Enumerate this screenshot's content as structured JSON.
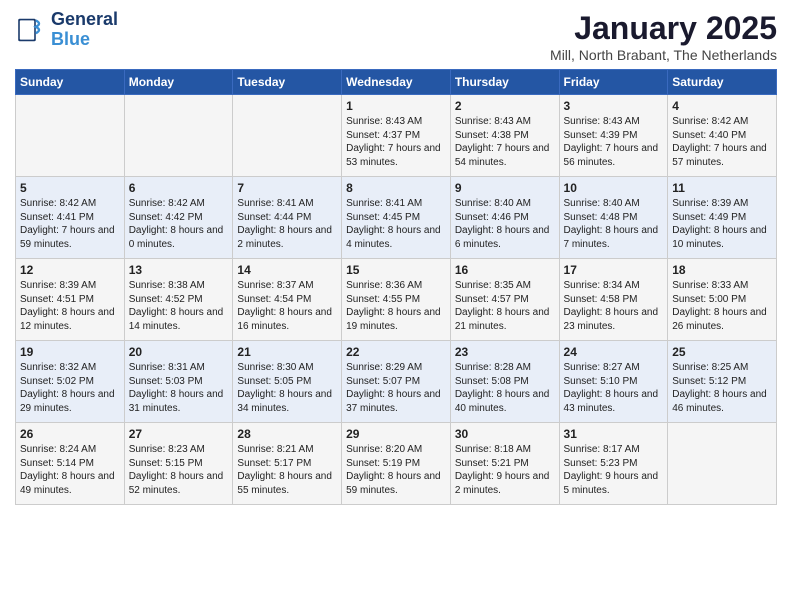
{
  "header": {
    "logo_line1": "General",
    "logo_line2": "Blue",
    "title": "January 2025",
    "subtitle": "Mill, North Brabant, The Netherlands"
  },
  "days_of_week": [
    "Sunday",
    "Monday",
    "Tuesday",
    "Wednesday",
    "Thursday",
    "Friday",
    "Saturday"
  ],
  "weeks": [
    [
      {
        "day": "",
        "info": ""
      },
      {
        "day": "",
        "info": ""
      },
      {
        "day": "",
        "info": ""
      },
      {
        "day": "1",
        "info": "Sunrise: 8:43 AM\nSunset: 4:37 PM\nDaylight: 7 hours and 53 minutes."
      },
      {
        "day": "2",
        "info": "Sunrise: 8:43 AM\nSunset: 4:38 PM\nDaylight: 7 hours and 54 minutes."
      },
      {
        "day": "3",
        "info": "Sunrise: 8:43 AM\nSunset: 4:39 PM\nDaylight: 7 hours and 56 minutes."
      },
      {
        "day": "4",
        "info": "Sunrise: 8:42 AM\nSunset: 4:40 PM\nDaylight: 7 hours and 57 minutes."
      }
    ],
    [
      {
        "day": "5",
        "info": "Sunrise: 8:42 AM\nSunset: 4:41 PM\nDaylight: 7 hours and 59 minutes."
      },
      {
        "day": "6",
        "info": "Sunrise: 8:42 AM\nSunset: 4:42 PM\nDaylight: 8 hours and 0 minutes."
      },
      {
        "day": "7",
        "info": "Sunrise: 8:41 AM\nSunset: 4:44 PM\nDaylight: 8 hours and 2 minutes."
      },
      {
        "day": "8",
        "info": "Sunrise: 8:41 AM\nSunset: 4:45 PM\nDaylight: 8 hours and 4 minutes."
      },
      {
        "day": "9",
        "info": "Sunrise: 8:40 AM\nSunset: 4:46 PM\nDaylight: 8 hours and 6 minutes."
      },
      {
        "day": "10",
        "info": "Sunrise: 8:40 AM\nSunset: 4:48 PM\nDaylight: 8 hours and 7 minutes."
      },
      {
        "day": "11",
        "info": "Sunrise: 8:39 AM\nSunset: 4:49 PM\nDaylight: 8 hours and 10 minutes."
      }
    ],
    [
      {
        "day": "12",
        "info": "Sunrise: 8:39 AM\nSunset: 4:51 PM\nDaylight: 8 hours and 12 minutes."
      },
      {
        "day": "13",
        "info": "Sunrise: 8:38 AM\nSunset: 4:52 PM\nDaylight: 8 hours and 14 minutes."
      },
      {
        "day": "14",
        "info": "Sunrise: 8:37 AM\nSunset: 4:54 PM\nDaylight: 8 hours and 16 minutes."
      },
      {
        "day": "15",
        "info": "Sunrise: 8:36 AM\nSunset: 4:55 PM\nDaylight: 8 hours and 19 minutes."
      },
      {
        "day": "16",
        "info": "Sunrise: 8:35 AM\nSunset: 4:57 PM\nDaylight: 8 hours and 21 minutes."
      },
      {
        "day": "17",
        "info": "Sunrise: 8:34 AM\nSunset: 4:58 PM\nDaylight: 8 hours and 23 minutes."
      },
      {
        "day": "18",
        "info": "Sunrise: 8:33 AM\nSunset: 5:00 PM\nDaylight: 8 hours and 26 minutes."
      }
    ],
    [
      {
        "day": "19",
        "info": "Sunrise: 8:32 AM\nSunset: 5:02 PM\nDaylight: 8 hours and 29 minutes."
      },
      {
        "day": "20",
        "info": "Sunrise: 8:31 AM\nSunset: 5:03 PM\nDaylight: 8 hours and 31 minutes."
      },
      {
        "day": "21",
        "info": "Sunrise: 8:30 AM\nSunset: 5:05 PM\nDaylight: 8 hours and 34 minutes."
      },
      {
        "day": "22",
        "info": "Sunrise: 8:29 AM\nSunset: 5:07 PM\nDaylight: 8 hours and 37 minutes."
      },
      {
        "day": "23",
        "info": "Sunrise: 8:28 AM\nSunset: 5:08 PM\nDaylight: 8 hours and 40 minutes."
      },
      {
        "day": "24",
        "info": "Sunrise: 8:27 AM\nSunset: 5:10 PM\nDaylight: 8 hours and 43 minutes."
      },
      {
        "day": "25",
        "info": "Sunrise: 8:25 AM\nSunset: 5:12 PM\nDaylight: 8 hours and 46 minutes."
      }
    ],
    [
      {
        "day": "26",
        "info": "Sunrise: 8:24 AM\nSunset: 5:14 PM\nDaylight: 8 hours and 49 minutes."
      },
      {
        "day": "27",
        "info": "Sunrise: 8:23 AM\nSunset: 5:15 PM\nDaylight: 8 hours and 52 minutes."
      },
      {
        "day": "28",
        "info": "Sunrise: 8:21 AM\nSunset: 5:17 PM\nDaylight: 8 hours and 55 minutes."
      },
      {
        "day": "29",
        "info": "Sunrise: 8:20 AM\nSunset: 5:19 PM\nDaylight: 8 hours and 59 minutes."
      },
      {
        "day": "30",
        "info": "Sunrise: 8:18 AM\nSunset: 5:21 PM\nDaylight: 9 hours and 2 minutes."
      },
      {
        "day": "31",
        "info": "Sunrise: 8:17 AM\nSunset: 5:23 PM\nDaylight: 9 hours and 5 minutes."
      },
      {
        "day": "",
        "info": ""
      }
    ]
  ]
}
